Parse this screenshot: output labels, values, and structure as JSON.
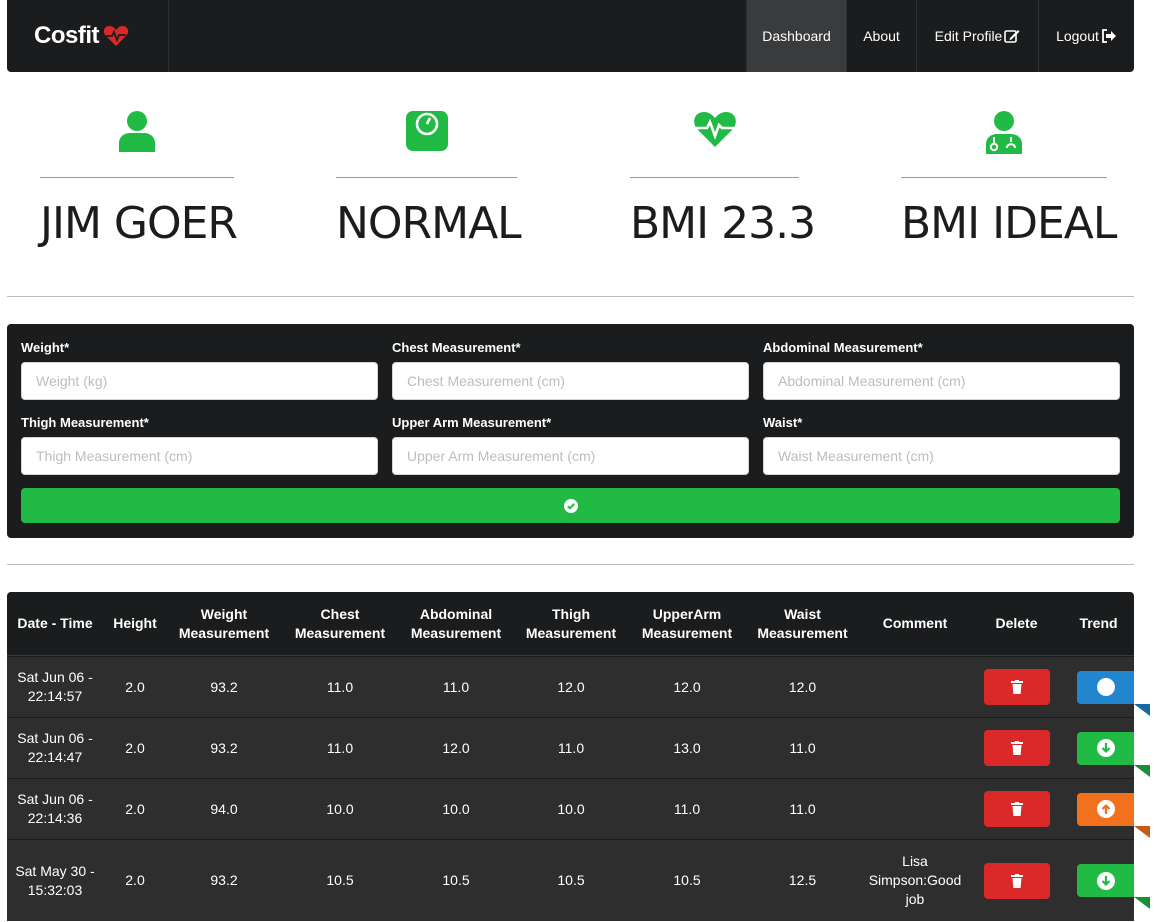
{
  "nav": {
    "brand": "Cosfit",
    "items": [
      {
        "label": "Dashboard",
        "active": true
      },
      {
        "label": "About"
      },
      {
        "label": "Edit Profile"
      },
      {
        "label": "Logout"
      }
    ]
  },
  "stats": [
    {
      "icon": "user-icon",
      "value": "JIM GOER"
    },
    {
      "icon": "scale-icon",
      "value": "NORMAL"
    },
    {
      "icon": "heartbeat-icon",
      "value": "BMI 23.3"
    },
    {
      "icon": "doctor-icon",
      "value": "BMI IDEAL"
    }
  ],
  "form": {
    "fields": [
      {
        "label": "Weight*",
        "placeholder": "Weight (kg)"
      },
      {
        "label": "Chest Measurement*",
        "placeholder": "Chest Measurement (cm)"
      },
      {
        "label": "Abdominal Measurement*",
        "placeholder": "Abdominal Measurement (cm)"
      },
      {
        "label": "Thigh Measurement*",
        "placeholder": "Thigh Measurement (cm)"
      },
      {
        "label": "Upper Arm Measurement*",
        "placeholder": "Upper Arm Measurement (cm)"
      },
      {
        "label": "Waist*",
        "placeholder": "Waist Measurement (cm)"
      }
    ],
    "submit_icon": "check-circle-icon"
  },
  "table": {
    "headers": [
      "Date - Time",
      "Height",
      "Weight Measurement",
      "Chest Measurement",
      "Abdominal Measurement",
      "Thigh Measurement",
      "UpperArm Measurement",
      "Waist Measurement",
      "Comment",
      "Delete",
      "Trend"
    ],
    "rows": [
      {
        "date": "Sat Jun 06 - 22:14:57",
        "height": "2.0",
        "weight": "93.2",
        "chest": "11.0",
        "abdominal": "11.0",
        "thigh": "12.0",
        "upperarm": "12.0",
        "waist": "12.0",
        "comment": "",
        "trend": "neutral",
        "trend_color": "#2185d0"
      },
      {
        "date": "Sat Jun 06 - 22:14:47",
        "height": "2.0",
        "weight": "93.2",
        "chest": "11.0",
        "abdominal": "12.0",
        "thigh": "11.0",
        "upperarm": "13.0",
        "waist": "11.0",
        "comment": "",
        "trend": "down",
        "trend_color": "#21ba45"
      },
      {
        "date": "Sat Jun 06 - 22:14:36",
        "height": "2.0",
        "weight": "94.0",
        "chest": "10.0",
        "abdominal": "10.0",
        "thigh": "10.0",
        "upperarm": "11.0",
        "waist": "11.0",
        "comment": "",
        "trend": "up",
        "trend_color": "#f2711c"
      },
      {
        "date": "Sat May 30 - 15:32:03",
        "height": "2.0",
        "weight": "93.2",
        "chest": "10.5",
        "abdominal": "10.5",
        "thigh": "10.5",
        "upperarm": "10.5",
        "waist": "12.5",
        "comment": "Lisa Simpson:Good job",
        "trend": "down",
        "trend_color": "#21ba45"
      }
    ]
  },
  "colors": {
    "accent": "#21ba45",
    "dark": "#1b1c1d",
    "danger": "#db2828"
  }
}
